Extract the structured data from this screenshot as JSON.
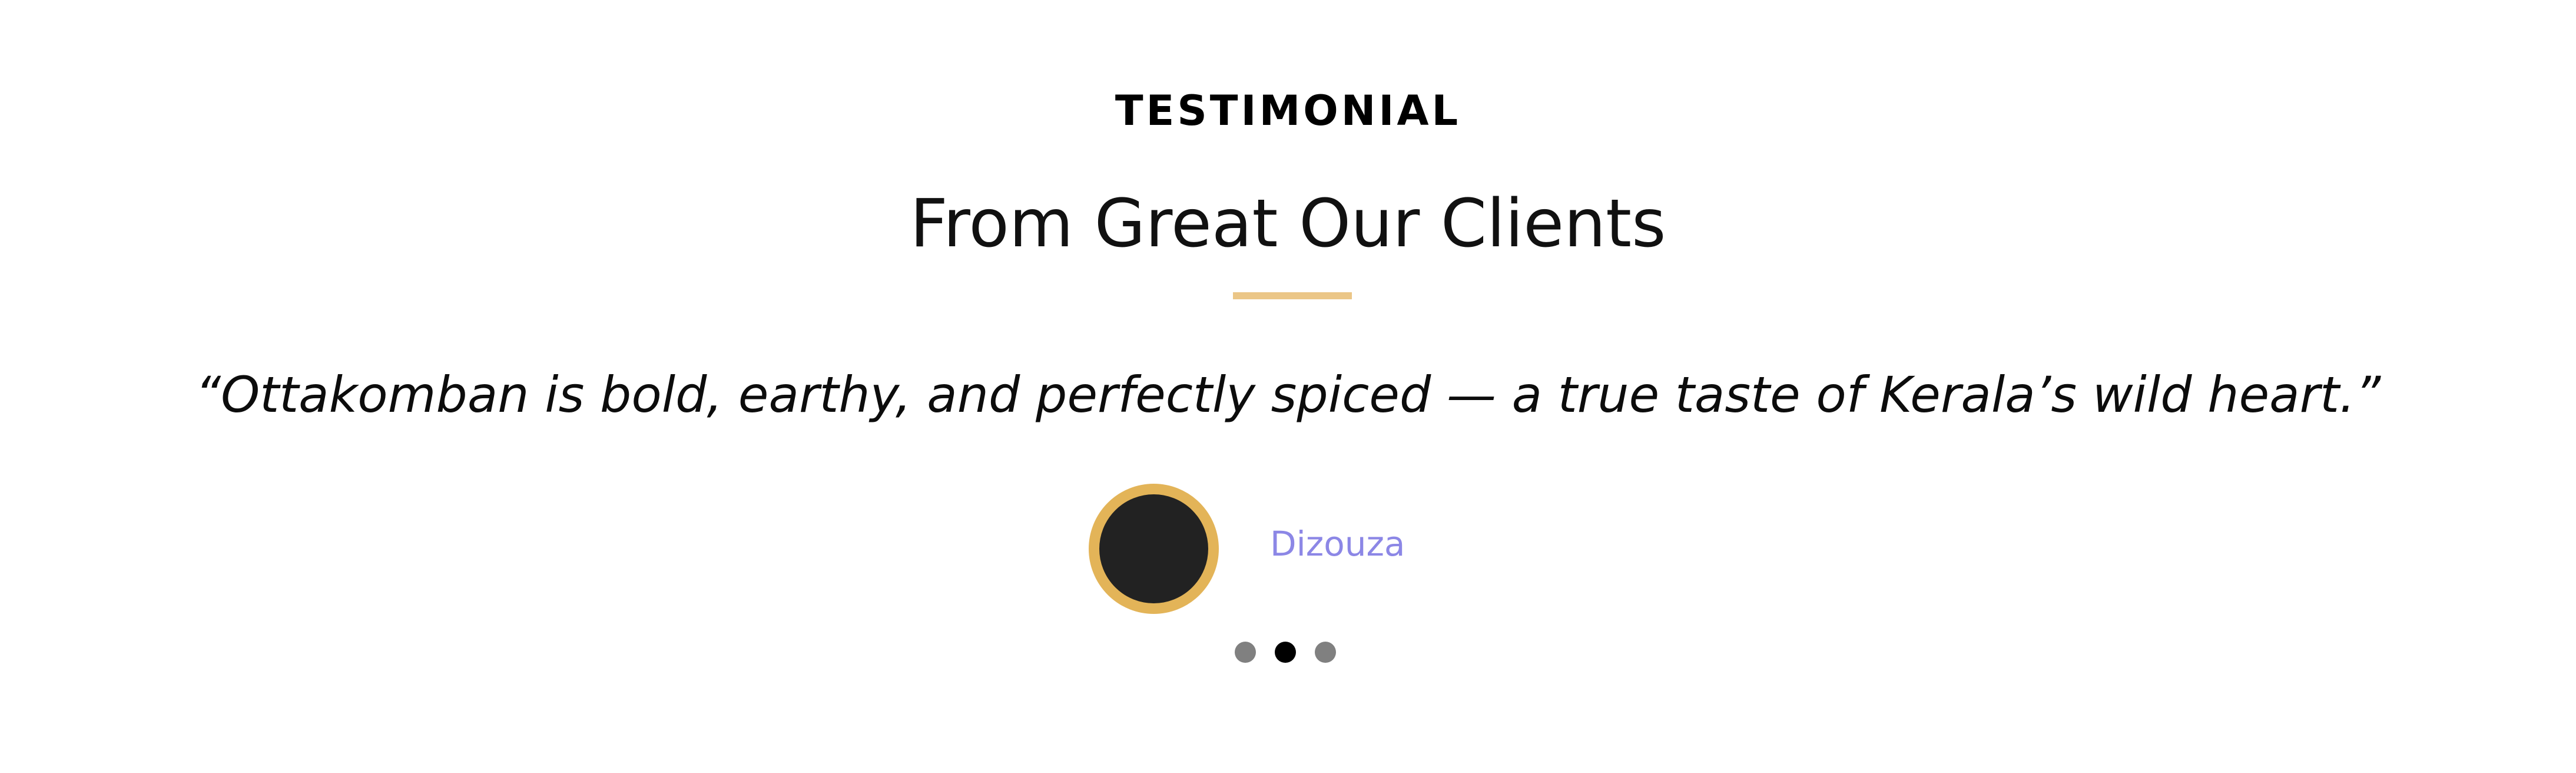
{
  "section": {
    "eyebrow": "TESTIMONIAL",
    "heading": "From Great Our Clients",
    "accent_color": "#EBC687"
  },
  "testimonial": {
    "quote": "“Ottakomban is bold, earthy, and perfectly spiced — a true taste of Kerala’s wild heart.”",
    "author": "Dizouza",
    "author_color": "#8C87E6",
    "avatar_ring_color": "#E3B458"
  },
  "carousel": {
    "total_slides": 3,
    "active_slide": 2
  }
}
